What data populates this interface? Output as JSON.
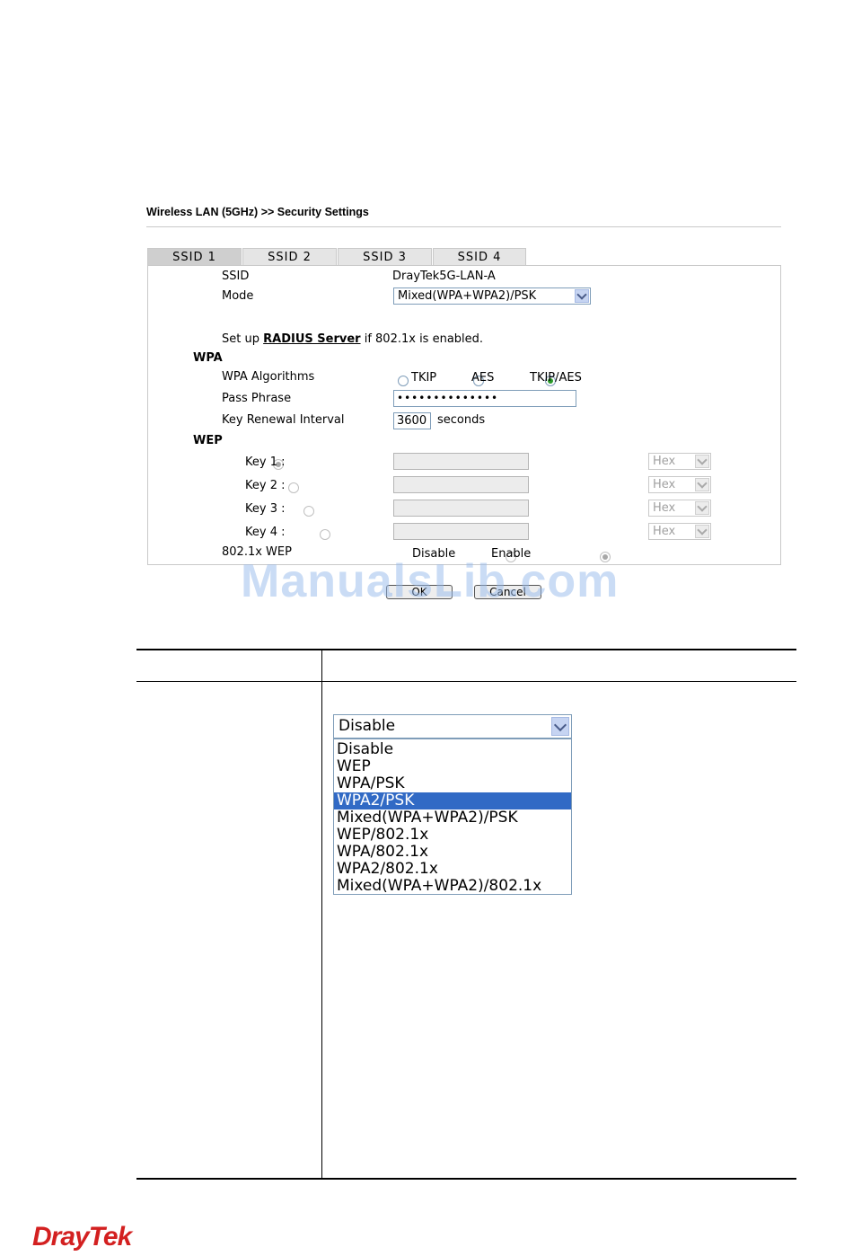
{
  "breadcrumb": "Wireless LAN (5GHz) >> Security Settings",
  "tabs": [
    "SSID 1",
    "SSID 2",
    "SSID 3",
    "SSID 4"
  ],
  "form": {
    "ssid_label": "SSID",
    "ssid_value": "DrayTek5G-LAN-A",
    "mode_label": "Mode",
    "mode_value": "Mixed(WPA+WPA2)/PSK",
    "radius_prefix": "Set up",
    "radius_link": "RADIUS Server",
    "radius_suffix": "if 802.1x is enabled.",
    "wpa_section": "WPA",
    "wpa_alg_label": "WPA Algorithms",
    "alg_tkip": "TKIP",
    "alg_aes": "AES",
    "alg_tkipaes": "TKIP/AES",
    "passphrase_label": "Pass Phrase",
    "passphrase_value": "••••••••••••••",
    "renewal_label": "Key Renewal Interval",
    "renewal_value": "3600",
    "renewal_unit": "seconds",
    "wep_section": "WEP",
    "keys": [
      "Key 1 :",
      "Key 2 :",
      "Key 3 :",
      "Key 4 :"
    ],
    "key_format": "Hex",
    "wep8021x_label": "802.1x WEP",
    "wep_disable": "Disable",
    "wep_enable": "Enable",
    "ok_label": "OK",
    "cancel_label": "Cancel"
  },
  "watermark": "ManualsLib.com",
  "mode_dropdown": {
    "selected": "Disable",
    "options": [
      "Disable",
      "WEP",
      "WPA/PSK",
      "WPA2/PSK",
      "Mixed(WPA+WPA2)/PSK",
      "WEP/802.1x",
      "WPA/802.1x",
      "WPA2/802.1x",
      "Mixed(WPA+WPA2)/802.1x"
    ],
    "highlighted": "WPA2/PSK"
  },
  "logo": "DrayTek"
}
